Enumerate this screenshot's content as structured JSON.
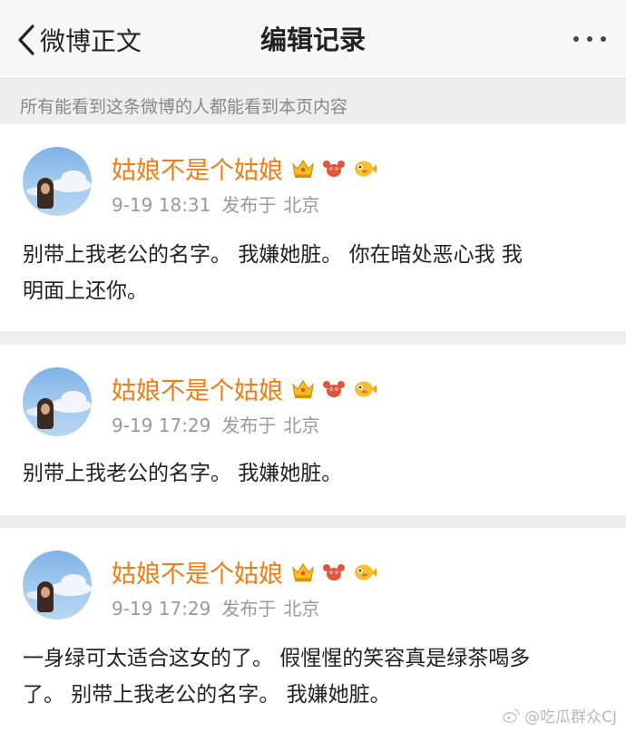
{
  "header": {
    "back_label": "微博正文",
    "title": "编辑记录"
  },
  "notice": "所有能看到这条微博的人都能看到本页内容",
  "posts": [
    {
      "username": "姑娘不是个姑娘",
      "time": "9-19 18:31",
      "published": "发布于",
      "location": "北京",
      "content_lines": [
        "别带上我老公的名字。   我嫌她脏。 你在暗处恶心我  我",
        "明面上还你。"
      ]
    },
    {
      "username": "姑娘不是个姑娘",
      "time": "9-19 17:29",
      "published": "发布于",
      "location": "北京",
      "content_lines": [
        "别带上我老公的名字。  我嫌她脏。"
      ]
    },
    {
      "username": "姑娘不是个姑娘",
      "time": "9-19 17:29",
      "published": "发布于",
      "location": "北京",
      "content_lines": [
        "一身绿可太适合这女的了。 假惺惺的笑容真是绿茶喝多",
        "了。  别带上我老公的名字。 我嫌她脏。"
      ]
    }
  ],
  "badges": [
    "crown-icon",
    "lobster-icon",
    "pufferfish-icon"
  ],
  "colors": {
    "username": "#f07c14",
    "meta": "#999999",
    "background": "#eeeeee"
  },
  "watermark": "@吃瓜群众CJ"
}
